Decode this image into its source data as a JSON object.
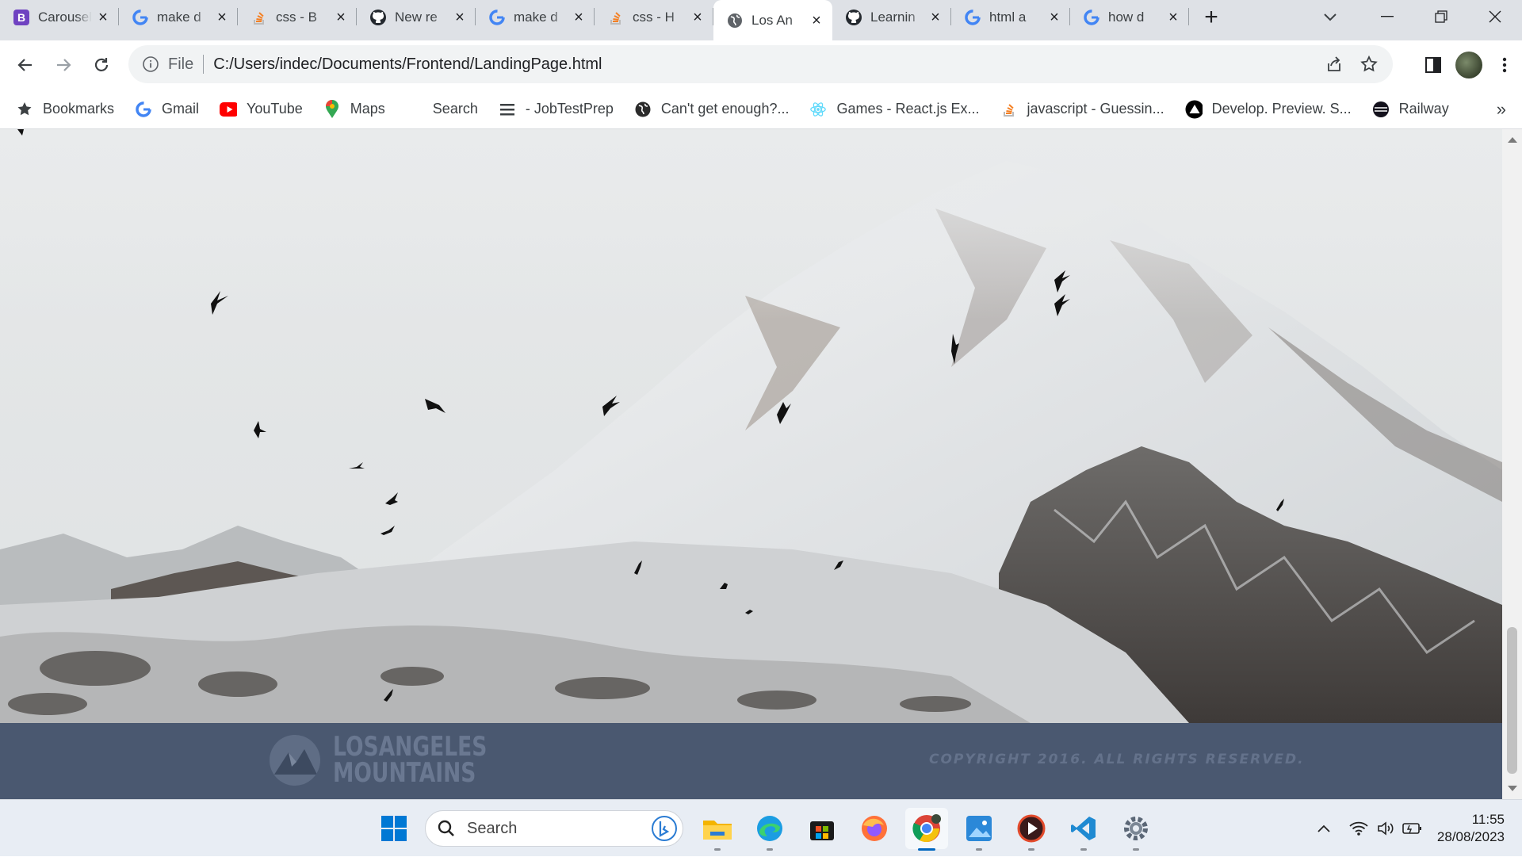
{
  "browser": {
    "tabs": [
      {
        "title": "Carousel",
        "favicon": "bootstrap-icon",
        "active": false
      },
      {
        "title": "make d",
        "favicon": "google-icon",
        "active": false
      },
      {
        "title": "css - B",
        "favicon": "stackoverflow-icon",
        "active": false
      },
      {
        "title": "New re",
        "favicon": "github-icon",
        "active": false
      },
      {
        "title": "make d",
        "favicon": "google-icon",
        "active": false
      },
      {
        "title": "css - H",
        "favicon": "stackoverflow-icon",
        "active": false
      },
      {
        "title": "Los An",
        "favicon": "globe-icon",
        "active": true
      },
      {
        "title": "Learnin",
        "favicon": "github-icon",
        "active": false
      },
      {
        "title": "html a",
        "favicon": "google-icon",
        "active": false
      },
      {
        "title": "how d",
        "favicon": "google-icon",
        "active": false
      }
    ],
    "address": {
      "scheme_label": "File",
      "url": "C:/Users/indec/Documents/Frontend/LandingPage.html"
    },
    "bookmarks": [
      {
        "label": "Bookmarks",
        "icon": "star-icon"
      },
      {
        "label": "Gmail",
        "icon": "google-icon"
      },
      {
        "label": "YouTube",
        "icon": "youtube-icon"
      },
      {
        "label": "Maps",
        "icon": "maps-icon"
      },
      {
        "label": "Search",
        "icon": "none"
      },
      {
        "label": "- JobTestPrep",
        "icon": "list-icon"
      },
      {
        "label": "Can't get enough?...",
        "icon": "globe-icon"
      },
      {
        "label": "Games - React.js Ex...",
        "icon": "react-icon"
      },
      {
        "label": "javascript - Guessin...",
        "icon": "stackoverflow-icon"
      },
      {
        "label": "Develop. Preview. S...",
        "icon": "vercel-icon"
      },
      {
        "label": "Railway",
        "icon": "railway-icon"
      }
    ],
    "more_label": "»"
  },
  "page": {
    "footer": {
      "logo_line1": "LOSANGELES",
      "logo_line2": "MOUNTAINS",
      "copyright": "COPYRIGHT 2016. ALL RIGHTS RESERVED."
    }
  },
  "taskbar": {
    "search_placeholder": "Search",
    "apps": [
      "windows-start-icon",
      "file-explorer-icon",
      "edge-icon",
      "store-icon",
      "firefox-icon",
      "chrome-icon",
      "photos-icon",
      "media-player-icon",
      "vscode-icon",
      "settings-icon"
    ],
    "time": "11:55",
    "date": "28/08/2023"
  },
  "colors": {
    "footer_bg": "#4a5870",
    "footer_text": "#64728b",
    "tabstrip_bg": "#dee1e6",
    "taskbar_active": "#0067c0"
  }
}
